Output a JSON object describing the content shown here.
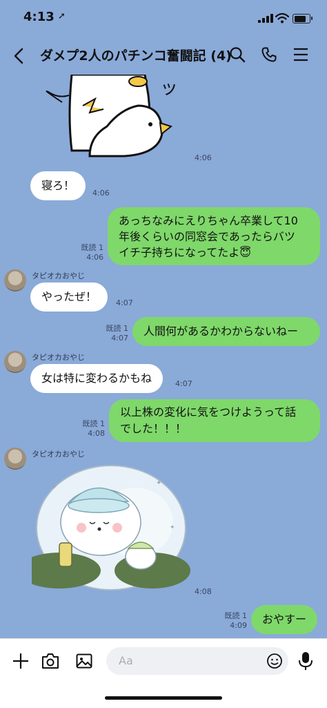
{
  "status": {
    "time": "4:13"
  },
  "header": {
    "title": "ダメプ2人のパチンコ奮闘記 (4)"
  },
  "messages": {
    "sticker1": {
      "time": "4:06"
    },
    "m1": {
      "text": "寝ろ！",
      "time": "4:06"
    },
    "m2": {
      "lines": [
        "あっちなみにえりちゃん卒業して10",
        "年後くらいの同窓会であったらバツ",
        "イチ子持ちになってたよ😇"
      ],
      "read": "既読 1",
      "time": "4:06"
    },
    "m3": {
      "sender": "タピオカおやじ",
      "text": "やったぜ！",
      "time": "4:07"
    },
    "m4": {
      "text": "人間何があるかわからないねー",
      "read": "既読 1",
      "time": "4:07"
    },
    "m5": {
      "sender": "タピオカおやじ",
      "text": "女は特に変わるかもね",
      "time": "4:07"
    },
    "m6": {
      "lines": [
        "以上株の変化に気をつけようって話",
        "でした！！！"
      ],
      "read": "既読 1",
      "time": "4:08"
    },
    "m7": {
      "sender": "タピオカおやじ",
      "time": "4:08"
    },
    "m8": {
      "text": "おやすー",
      "read": "既読 1",
      "time": "4:09"
    }
  },
  "composer": {
    "placeholder": "Aa"
  },
  "colors": {
    "background": "#8aaad8",
    "sent_bubble": "#7fd86a",
    "received_bubble": "#ffffff"
  }
}
